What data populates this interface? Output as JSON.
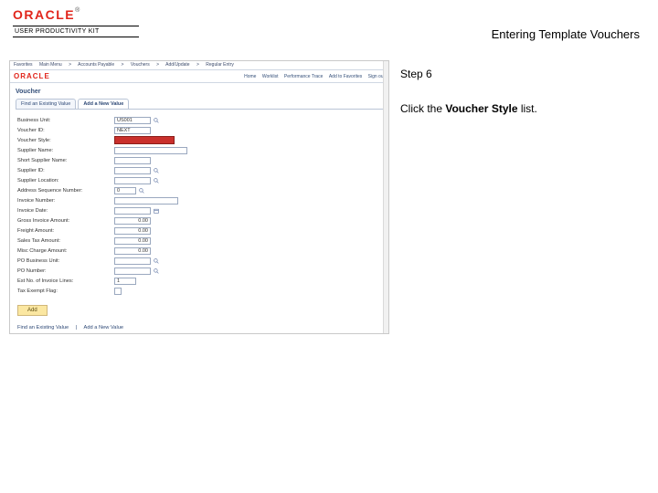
{
  "header": {
    "brand": "ORACLE",
    "tm": "®",
    "upk": "USER PRODUCTIVITY KIT",
    "title": "Entering Template Vouchers"
  },
  "instructions": {
    "step_label": "Step 6",
    "preface": "Click the ",
    "bold": "Voucher Style",
    "suffix": " list."
  },
  "shot": {
    "menu": {
      "m1": "Favorites",
      "m2": "Main Menu",
      "m3": "Accounts Payable",
      "m4": "Vouchers",
      "m5": "Add/Update",
      "m6": "Regular Entry"
    },
    "brand": "ORACLE",
    "nav": {
      "n1": "Home",
      "n2": "Worklist",
      "n3": "Performance Trace",
      "n4": "Add to Favorites",
      "n5": "Sign out"
    },
    "page_title": "Voucher",
    "tabs": {
      "t1": "Find an Existing Value",
      "t2": "Add a New Value"
    },
    "labels": {
      "bu": "Business Unit:",
      "vid": "Voucher ID:",
      "vstyle": "Voucher Style:",
      "supname": "Supplier Name:",
      "shortsup": "Short Supplier Name:",
      "supid": "Supplier ID:",
      "suploc": "Supplier Location:",
      "addrseq": "Address Sequence Number:",
      "invnum": "Invoice Number:",
      "invdate": "Invoice Date:",
      "gross": "Gross Invoice Amount:",
      "freight": "Freight Amount:",
      "salestax": "Sales Tax Amount:",
      "misc": "Misc Charge Amount:",
      "pobu": "PO Business Unit:",
      "ponum": "PO Number:",
      "estlines": "Est No. of Invoice Lines:",
      "taxexempt": "Tax Exempt Flag:"
    },
    "values": {
      "bu": "US001",
      "vid": "NEXT",
      "addrseq": "0",
      "gross_amt": "0.00",
      "freight_amt": "0.00",
      "salestax_amt": "0.00",
      "misc_amt": "0.00",
      "estlines": "1"
    },
    "add_button": "Add",
    "footer": {
      "f1": "Find an Existing Value",
      "f2": "Add a New Value"
    }
  }
}
